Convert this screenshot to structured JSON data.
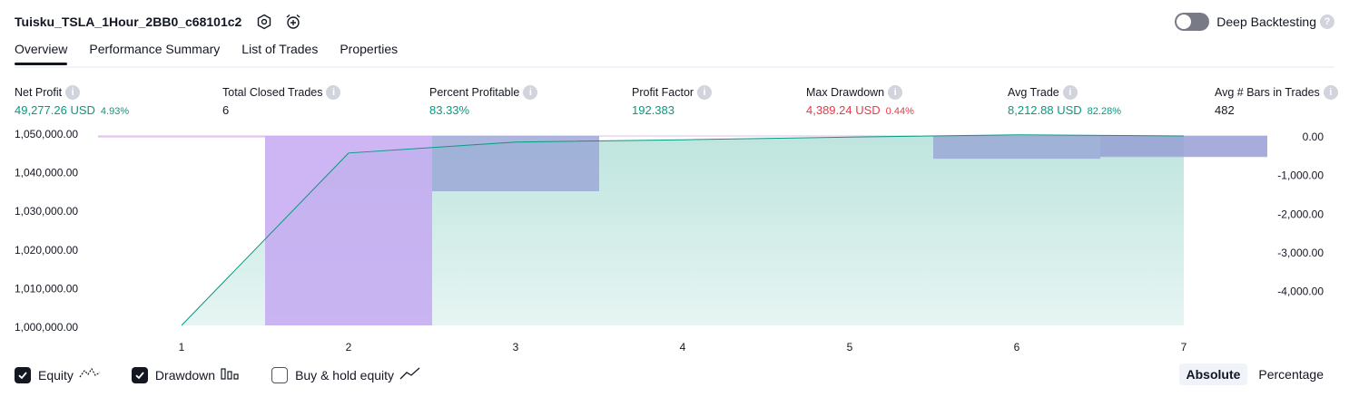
{
  "header": {
    "strategy_name": "Tuisku_TSLA_1Hour_2BB0_c68101c2",
    "deep_backtesting_label": "Deep Backtesting",
    "deep_backtesting_enabled": false
  },
  "tabs": [
    {
      "label": "Overview",
      "active": true
    },
    {
      "label": "Performance Summary",
      "active": false
    },
    {
      "label": "List of Trades",
      "active": false
    },
    {
      "label": "Properties",
      "active": false
    }
  ],
  "metrics": [
    {
      "label": "Net Profit",
      "value": "49,277.26 USD",
      "pct": "4.93%",
      "color": "green"
    },
    {
      "label": "Total Closed Trades",
      "value": "6",
      "pct": "",
      "color": "dark"
    },
    {
      "label": "Percent Profitable",
      "value": "83.33%",
      "pct": "",
      "color": "green"
    },
    {
      "label": "Profit Factor",
      "value": "192.383",
      "pct": "",
      "color": "green"
    },
    {
      "label": "Max Drawdown",
      "value": "4,389.24 USD",
      "pct": "0.44%",
      "color": "red"
    },
    {
      "label": "Avg Trade",
      "value": "8,212.88 USD",
      "pct": "82.28%",
      "color": "green"
    },
    {
      "label": "Avg # Bars in Trades",
      "value": "482",
      "pct": "",
      "color": "dark"
    }
  ],
  "chart_data": {
    "type": "area",
    "x": [
      1,
      2,
      3,
      4,
      5,
      6,
      7
    ],
    "y_left_ticks": [
      "1,050,000.00",
      "1,040,000.00",
      "1,030,000.00",
      "1,020,000.00",
      "1,010,000.00",
      "1,000,000.00"
    ],
    "y_left_range": [
      1000000,
      1050000
    ],
    "y_right_ticks": [
      "0.00",
      "-1,000.00",
      "-2,000.00",
      "-3,000.00",
      "-4,000.00"
    ],
    "y_right_range": [
      -4900,
      0
    ],
    "series": [
      {
        "name": "Equity",
        "type": "area",
        "color": "#089981",
        "values": [
          1000000,
          1045500,
          1048400,
          1049000,
          1049700,
          1050300,
          1050000
        ]
      },
      {
        "name": "Drawdown",
        "type": "bar",
        "values": [
          null,
          -4900,
          -1430,
          0,
          0,
          -590,
          -545
        ],
        "colors": [
          null,
          "#c3a6f2",
          "#9aa6d6",
          null,
          null,
          "#9aa6d6",
          "#9aa6d6"
        ]
      },
      {
        "name": "Buy & hold equity",
        "type": "bar_overlay",
        "segments": [
          {
            "from": 0.5,
            "to": 1.5,
            "value": -40,
            "color": "#e1bee7"
          },
          {
            "from": 6.5,
            "to": 7.5,
            "value": -520,
            "color": "#e1bee7"
          }
        ]
      }
    ]
  },
  "legend": [
    {
      "label": "Equity",
      "checked": true,
      "icon": "equity-line-icon"
    },
    {
      "label": "Drawdown",
      "checked": true,
      "icon": "drawdown-bars-icon"
    },
    {
      "label": "Buy & hold equity",
      "checked": false,
      "icon": "buy-hold-line-icon"
    }
  ],
  "modes": [
    {
      "label": "Absolute",
      "active": true
    },
    {
      "label": "Percentage",
      "active": false
    }
  ]
}
